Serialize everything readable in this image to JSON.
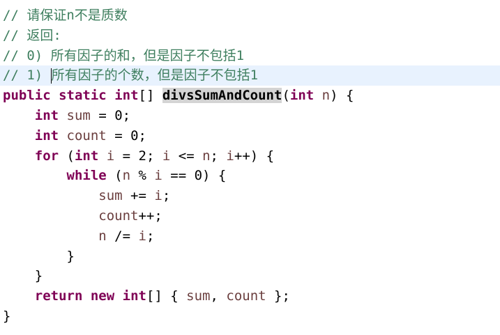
{
  "editor": {
    "line1": {
      "text": "// 请保证n不是质数"
    },
    "line2": {
      "text": "// 返回:"
    },
    "line3": {
      "text": "// 0) 所有因子的和，但是因子不包括1"
    },
    "line4": {
      "prefix": "// 1) ",
      "text": "所有因子的个数，但是因子不包括1"
    },
    "line5": {
      "kw1": "public",
      "kw2": "static",
      "kw3": "int",
      "brackets": "[] ",
      "method": "divsSumAndCount",
      "open": "(",
      "kw4": "int",
      "param": "n",
      "close": ") {"
    },
    "line6": {
      "kw": "int",
      "var": "sum",
      "rest": " = 0;"
    },
    "line7": {
      "kw": "int",
      "var": "count",
      "rest": " = 0;"
    },
    "line8": {
      "kw1": "for",
      "p1": " (",
      "kw2": "int",
      "v1": "i",
      "p2": " = 2; ",
      "v2": "i",
      "p3": " <= ",
      "v3": "n",
      "p4": "; ",
      "v4": "i",
      "p5": "++) {"
    },
    "line9": {
      "kw": "while",
      "p1": " (",
      "v1": "n",
      "p2": " % ",
      "v2": "i",
      "p3": " == 0) {"
    },
    "line10": {
      "v1": "sum",
      "p1": " += ",
      "v2": "i",
      "p2": ";"
    },
    "line11": {
      "v1": "count",
      "p1": "++;"
    },
    "line12": {
      "v1": "n",
      "p1": " /= ",
      "v2": "i",
      "p2": ";"
    },
    "line13": {
      "text": "}"
    },
    "line14": {
      "text": "}"
    },
    "line15": {
      "kw1": "return",
      "kw2": "new",
      "kw3": "int",
      "p1": "[] { ",
      "v1": "sum",
      "p2": ", ",
      "v2": "count",
      "p3": " };"
    },
    "line16": {
      "text": "}"
    }
  }
}
